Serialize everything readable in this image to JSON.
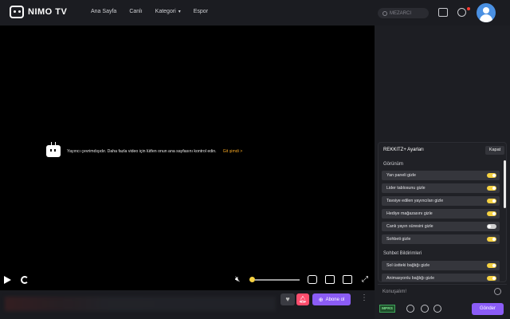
{
  "header": {
    "logo_text": "NIMO TV",
    "nav": [
      {
        "label": "Ana Sayfa"
      },
      {
        "label": "Canlı"
      },
      {
        "label": "Kategori"
      },
      {
        "label": "Espor"
      }
    ],
    "search_placeholder": "MEZARCI"
  },
  "player": {
    "offline_message": "Yayıncı çevrimdışıdır. Daha fazla video için lütfen onun ana sayfasını kontrol edin.",
    "offline_link": "Git şimdi >",
    "volume_level": 0.02
  },
  "actions": {
    "follow_label": "Abone ol"
  },
  "rekkitz": {
    "title": "REKKITZ+ Ayarları",
    "close_label": "Kapat",
    "section_view": "Görünüm",
    "view_items": [
      {
        "label": "Yan paneli gizle",
        "on": true
      },
      {
        "label": "Lider tablosunu gizle",
        "on": true
      },
      {
        "label": "Tavsiye edilen yayıncıları gizle",
        "on": true
      },
      {
        "label": "Hediye mağazasını gizle",
        "on": true
      },
      {
        "label": "Canlı yayın süresini gizle",
        "on": false
      },
      {
        "label": "Sohbeti gizle",
        "on": true
      }
    ],
    "section_chat": "Sohbet Bildirimleri",
    "chat_items": [
      {
        "label": "Sol üstteki bağlığı gizle",
        "on": true
      },
      {
        "label": "Animasyonlu bağlığı gizle",
        "on": true
      }
    ]
  },
  "chat": {
    "placeholder": "Konuşalım!",
    "badge": "MPRS",
    "send_label": "Gönder"
  },
  "colors": {
    "accent_purple": "#8b5cf6",
    "toggle_on": "#f5d142",
    "link_orange": "#f5a623"
  }
}
